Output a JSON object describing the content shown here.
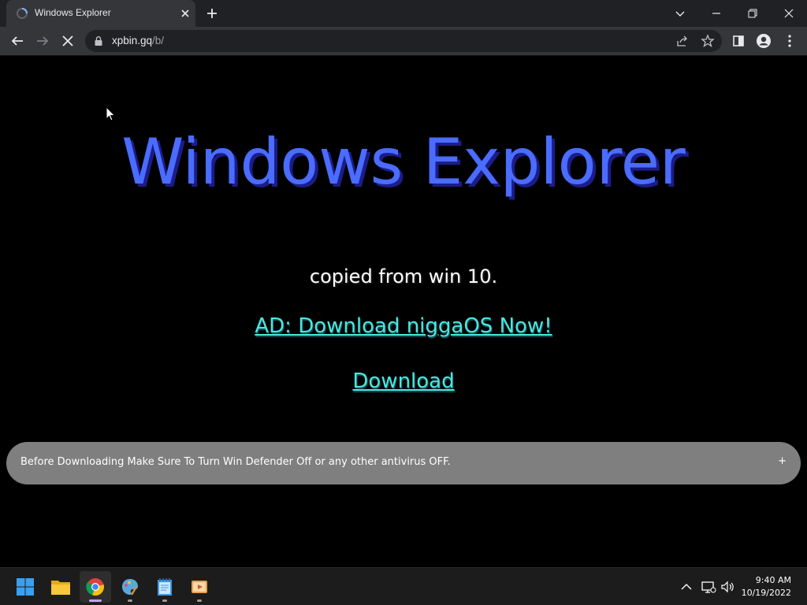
{
  "browser": {
    "tab_title": "Windows Explorer",
    "url_host": "xpbin.gq",
    "url_path": "/b/"
  },
  "page": {
    "heading": "Windows Explorer",
    "subtitle": "copied from win 10.",
    "ad_link": "AD: Download niggaOS Now!",
    "download_link": "Download",
    "notice_text": "Before Downloading Make Sure To Turn Win Defender Off or any other antivirus OFF.",
    "notice_toggle": "+"
  },
  "taskbar": {
    "apps": [
      "start-icon",
      "file-explorer-icon",
      "chrome-icon",
      "paint-icon",
      "notepad-icon",
      "media-player-icon"
    ],
    "time": "9:40 AM",
    "date": "10/19/2022"
  },
  "colors": {
    "heading": "#4a6cff",
    "link": "#47e8e0",
    "notice_bg": "#7f7f7f"
  }
}
